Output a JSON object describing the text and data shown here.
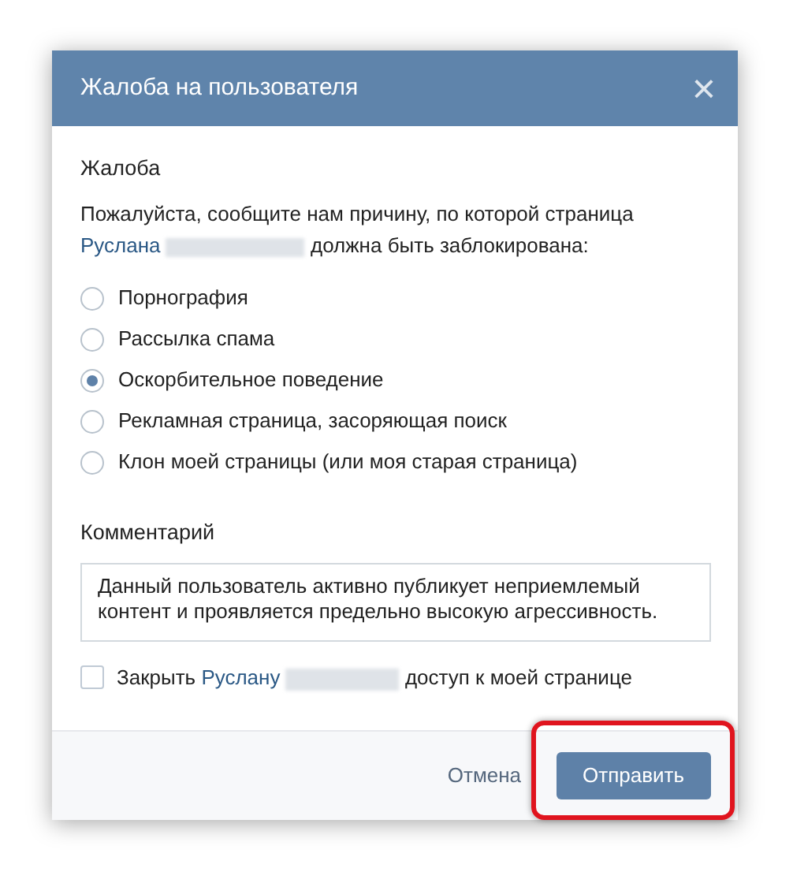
{
  "dialog": {
    "title": "Жалоба на пользователя",
    "close": "×"
  },
  "section_title": "Жалоба",
  "prompt": {
    "before": "Пожалуйста, сообщите нам причину, по которой страница",
    "link": "Руслана",
    "after": "должна быть заблокирована:"
  },
  "reasons": [
    {
      "label": "Порнография",
      "selected": false
    },
    {
      "label": "Рассылка спама",
      "selected": false
    },
    {
      "label": "Оскорбительное поведение",
      "selected": true
    },
    {
      "label": "Рекламная страница, засоряющая поиск",
      "selected": false
    },
    {
      "label": "Клон моей страницы (или моя старая страница)",
      "selected": false
    }
  ],
  "comment": {
    "label": "Комментарий",
    "value": "Данный пользователь активно публикует неприемлемый контент и проявляется предельно высокую агрессивность."
  },
  "block_access": {
    "checked": false,
    "before": "Закрыть",
    "link": "Руслану",
    "after": "доступ к моей странице"
  },
  "buttons": {
    "cancel": "Отмена",
    "submit": "Отправить"
  }
}
